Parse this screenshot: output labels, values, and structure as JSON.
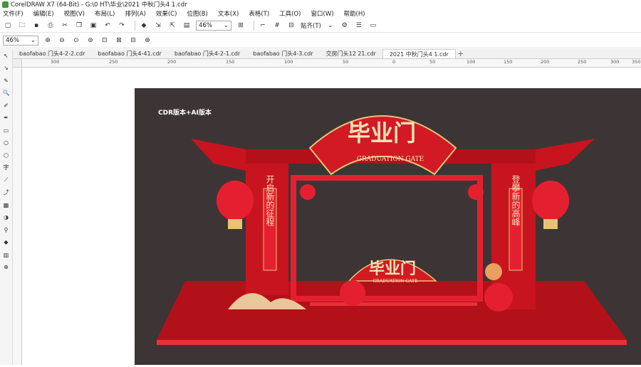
{
  "window": {
    "title": "CorelDRAW X7 (64-Bit) - G:\\0 HT\\毕业\\2021 中秋门头4 1.cdr"
  },
  "menu": [
    "文件(F)",
    "编辑(E)",
    "视图(V)",
    "布局(L)",
    "排列(A)",
    "效果(C)",
    "位图(B)",
    "文本(X)",
    "表格(T)",
    "工具(O)",
    "窗口(W)",
    "帮助(H)"
  ],
  "toolbar": {
    "zoom_value": "46%",
    "snap_label": "贴齐(T)"
  },
  "toolbar2": {
    "zoom_value": "46%"
  },
  "tabs": [
    "baofabao 门头4-2-2.cdr",
    "baofabao 门头4-41.cdr",
    "baofabao 门头4-2-1.cdr",
    "baofabao 门头4-3.cdr",
    "交房门头12 21.cdr",
    "2021 中秋门头4 1.cdr"
  ],
  "active_tab_index": 5,
  "ruler_labels": [
    "300",
    "250",
    "200",
    "150",
    "100",
    "50",
    "0",
    "50",
    "100",
    "150",
    "200",
    "250",
    "300",
    "350"
  ],
  "artwork": {
    "watermark": "CDR版本+AI版本",
    "arch_title": "毕业门",
    "arch_subtitle": "GRADUATION GATE",
    "small_title": "毕业门",
    "small_subtitle": "GRADUATION GATE",
    "left_banner": "开启新的征程",
    "right_banner": "登攀新的高峰"
  },
  "colors": {
    "artboard": "#3d3535",
    "red": "#c8141e",
    "gold": "#e9c27a",
    "floor": "#b3111a"
  }
}
